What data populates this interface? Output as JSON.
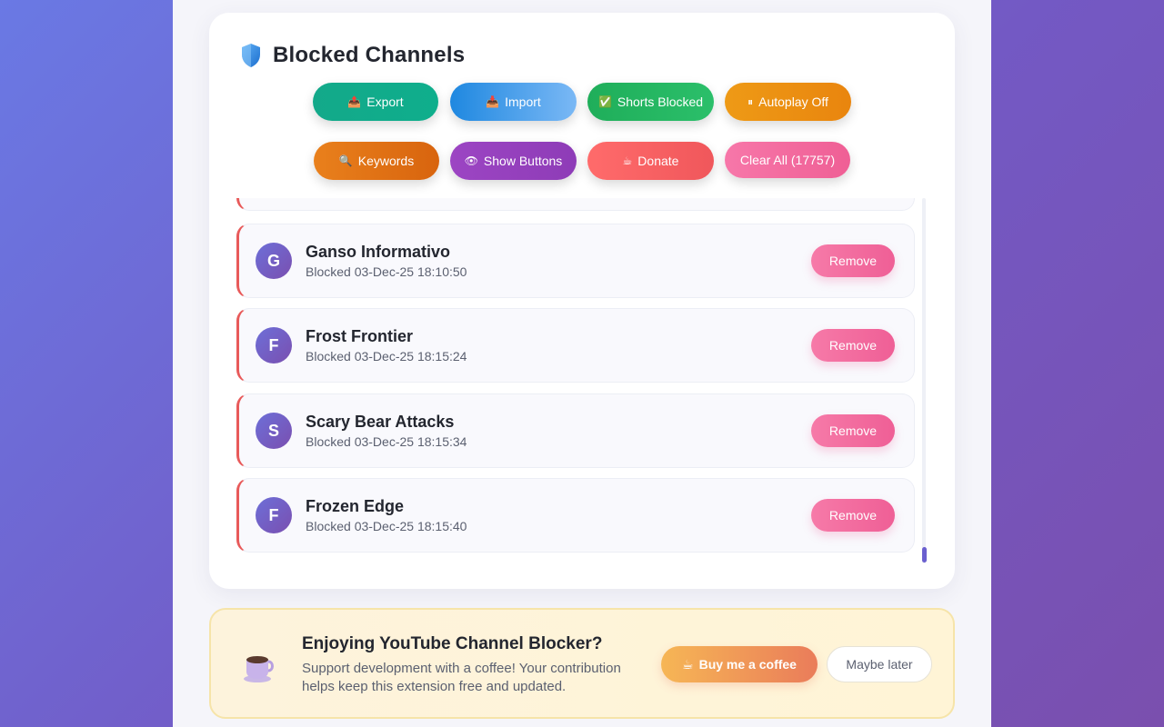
{
  "header": {
    "title": "Blocked Channels",
    "icon": "shield-icon"
  },
  "toolbar": {
    "row1": [
      {
        "label": "Export",
        "icon": "outbox-icon",
        "color": "#13a98a"
      },
      {
        "label": "Import",
        "icon": "inbox-icon",
        "color": "#1f88e0"
      },
      {
        "label": "Shorts Blocked",
        "icon": "check-icon",
        "color": "#1fae5a"
      },
      {
        "label": "Autoplay Off",
        "icon": "pause-icon",
        "color": "#ee9a16"
      }
    ],
    "row2": [
      {
        "label": "Keywords",
        "icon": "magnifier-icon",
        "color": "#e9801c"
      },
      {
        "label": "Show Buttons",
        "icon": "eye-icon",
        "color": "#9c45c3"
      },
      {
        "label": "Donate",
        "icon": "coffee-icon",
        "color": "#ff6b6b"
      },
      {
        "label": "Clear All (17757)",
        "color": "#f777a9"
      }
    ]
  },
  "channels": [
    {
      "initial": "G",
      "name": "Ganso Informativo",
      "blocked": "Blocked 03-Dec-25 18:10:50",
      "remove_label": "Remove"
    },
    {
      "initial": "F",
      "name": "Frost Frontier",
      "blocked": "Blocked 03-Dec-25 18:15:24",
      "remove_label": "Remove"
    },
    {
      "initial": "S",
      "name": "Scary Bear Attacks",
      "blocked": "Blocked 03-Dec-25 18:15:34",
      "remove_label": "Remove"
    },
    {
      "initial": "F",
      "name": "Frozen Edge",
      "blocked": "Blocked 03-Dec-25 18:15:40",
      "remove_label": "Remove"
    }
  ],
  "banner": {
    "title": "Enjoying YouTube Channel Blocker?",
    "text": "Support development with a coffee! Your contribution helps keep this extension free and updated.",
    "buy_label": "Buy me a coffee",
    "later_label": "Maybe later"
  },
  "colors": {
    "accent": "#6a5fcf",
    "remove": "#ef5f96",
    "row_border_left": "#e85a5a"
  }
}
